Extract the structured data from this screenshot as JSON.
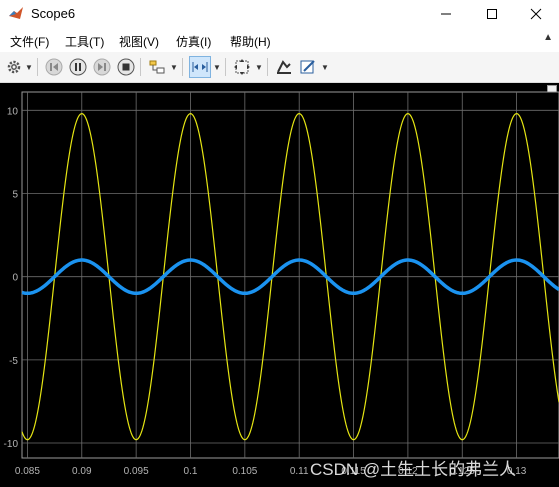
{
  "window": {
    "title": "Scope6",
    "minimize_icon": "minimize-icon",
    "maximize_icon": "maximize-icon",
    "close_icon": "close-icon"
  },
  "menu": {
    "items": [
      "文件(F)",
      "工具(T)",
      "视图(V)",
      "仿真(I)",
      "帮助(H)"
    ]
  },
  "toolbar": {
    "icons": [
      "gear-icon",
      "step-back-icon",
      "pause-icon",
      "step-forward-icon",
      "stop-icon",
      "highlight-block-icon",
      "zoom-x-icon",
      "fit-to-view-icon",
      "legend-icon",
      "style-icon"
    ]
  },
  "watermark": "CSDN @土生土长的弗兰人",
  "colors": {
    "background": "#000000",
    "grid": "#6e6e6e",
    "axis_text": "#b4b4b4",
    "series_yellow": "#e5e513",
    "series_blue": "#1b93f0"
  },
  "chart_data": {
    "type": "line",
    "x_ticks": [
      "0.085",
      "0.09",
      "0.095",
      "0.1",
      "0.105",
      "0.11",
      "0.115",
      "0.12",
      "0.125",
      "0.13"
    ],
    "y_ticks": [
      "10",
      "5",
      "0",
      "-5",
      "-10"
    ],
    "xlim": [
      0.0845,
      0.1339
    ],
    "ylim": [
      -10.9,
      11.1
    ],
    "grid": true,
    "series": [
      {
        "color": "#e5e513",
        "amplitude": 9.8,
        "frequency_hz": 100,
        "phase_deg": 90,
        "line": "thin"
      },
      {
        "color": "#1b93f0",
        "amplitude": 1.0,
        "frequency_hz": 100,
        "phase_deg": 90,
        "line": "thick"
      }
    ]
  }
}
